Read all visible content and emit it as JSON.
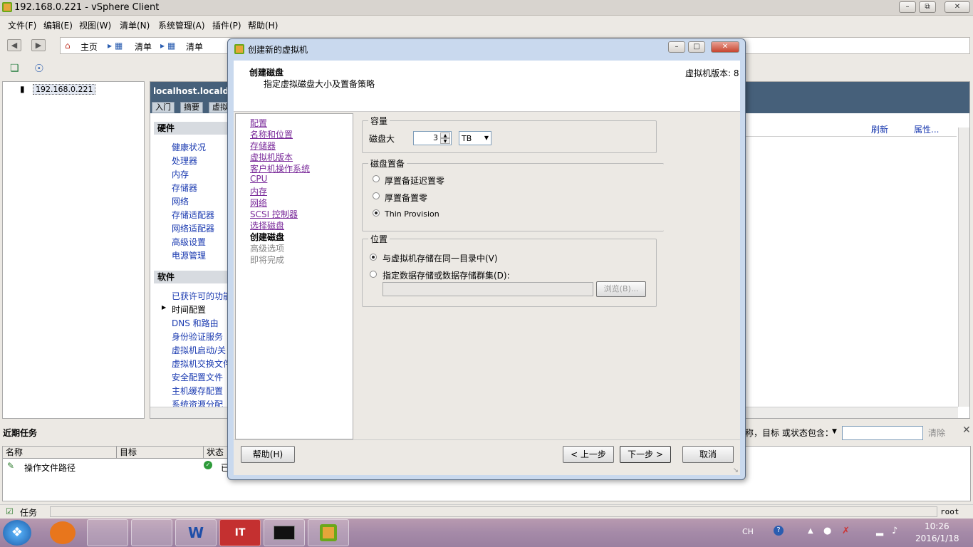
{
  "window": {
    "title": "192.168.0.221 - vSphere Client"
  },
  "menu": [
    "文件(F)",
    "编辑(E)",
    "视图(W)",
    "清单(N)",
    "系统管理(A)",
    "插件(P)",
    "帮助(H)"
  ],
  "address": {
    "home": "主页",
    "crumb1": "清单",
    "crumb2": "清单"
  },
  "tree": {
    "host": "192.168.0.221"
  },
  "host_panel": {
    "name": "localhost.localdom",
    "tabs": [
      "入门",
      "摘要",
      "虚拟"
    ],
    "hardware_title": "硬件",
    "hardware_items": [
      "健康状况",
      "处理器",
      "内存",
      "存储器",
      "网络",
      "存储适配器",
      "网络适配器",
      "高级设置",
      "电源管理"
    ],
    "software_title": "软件",
    "software_items": [
      "已获许可的功能",
      "时间配置",
      "DNS 和路由",
      "身份验证服务",
      "虚拟机启动/关",
      "虚拟机交换文件",
      "安全配置文件",
      "主机缓存配置",
      "系统资源分配"
    ],
    "refresh": "刷新",
    "properties": "属性..."
  },
  "recent_tasks": {
    "title": "近期任务",
    "filter_label": "称，目标 或状态包含：",
    "clear": "清除",
    "columns": [
      "名称",
      "目标",
      "状态"
    ],
    "row": {
      "name": "操作文件路径",
      "status": "已"
    }
  },
  "statusbar": {
    "tasks": "任务",
    "user": "root"
  },
  "tray": {
    "lang": "CH",
    "time": "10:26",
    "date": "2016/1/18"
  },
  "dialog": {
    "title": "创建新的虚拟机",
    "heading": "创建磁盘",
    "subheading": "指定虚拟磁盘大小及置备策略",
    "vm_version": "虚拟机版本: 8",
    "steps": [
      "配置",
      "名称和位置",
      "存储器",
      "虚拟机版本",
      "客户机操作系统",
      "CPU",
      "内存",
      "网络",
      "SCSI 控制器",
      "选择磁盘"
    ],
    "current_step": "创建磁盘",
    "pending_steps": [
      "高级选项",
      "即将完成"
    ],
    "capacity": {
      "group": "容量",
      "label": "磁盘大",
      "value": "3",
      "unit": "TB"
    },
    "provisioning": {
      "group": "磁盘置备",
      "options": [
        "厚置备延迟置零",
        "厚置备置零",
        "Thin Provision"
      ],
      "selected": 2
    },
    "location": {
      "group": "位置",
      "options": [
        "与虚拟机存储在同一目录中(V)",
        "指定数据存储或数据存储群集(D):"
      ],
      "selected": 0,
      "browse": "浏览(B)..."
    },
    "buttons": {
      "help": "帮助(H)",
      "back": "< 上一步",
      "next": "下一步 >",
      "cancel": "取消"
    }
  }
}
